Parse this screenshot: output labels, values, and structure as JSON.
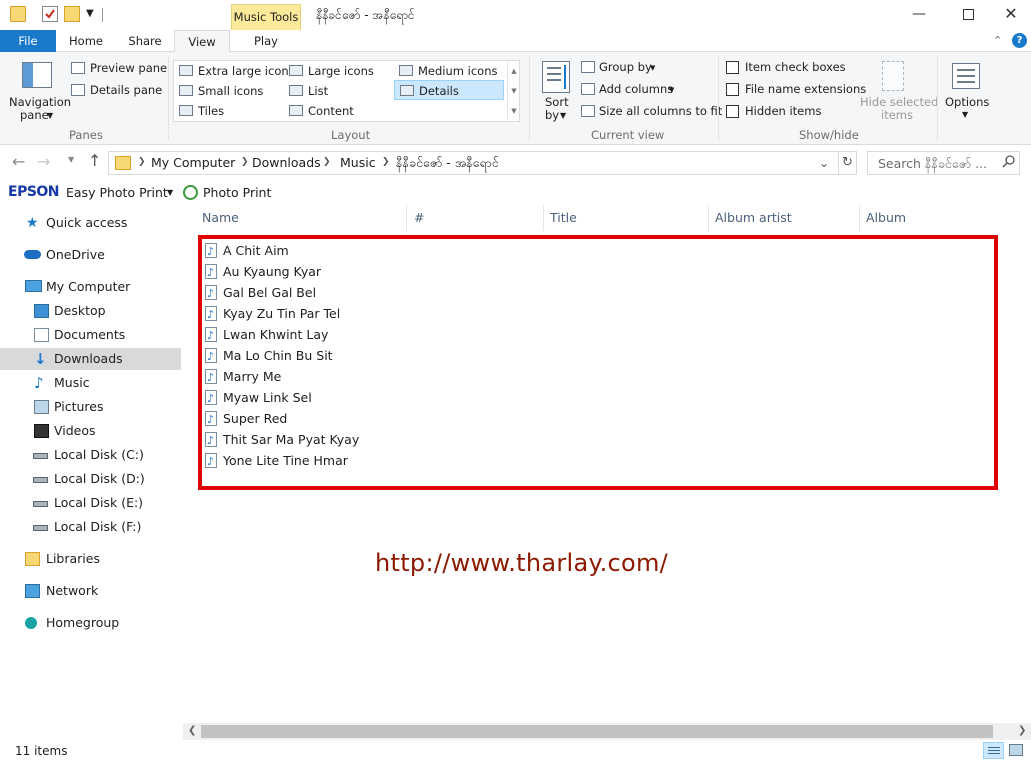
{
  "window": {
    "title": "နီနီခင်ဇော် - အနီရောင်",
    "contextual_tab": "Music Tools",
    "controls": [
      "minimize",
      "maximize",
      "close"
    ]
  },
  "ribbon_tabs": {
    "file": "File",
    "home": "Home",
    "share": "Share",
    "view": "View",
    "play": "Play",
    "active": "View"
  },
  "ribbon": {
    "panes": {
      "navigation_pane": "Navigation",
      "navigation_pane_2": "pane",
      "preview_pane": "Preview pane",
      "details_pane": "Details pane",
      "label": "Panes"
    },
    "layout": {
      "items": [
        "Extra large icons",
        "Large icons",
        "Medium icons",
        "Small icons",
        "List",
        "Details",
        "Tiles",
        "Content"
      ],
      "selected": "Details",
      "label": "Layout"
    },
    "current_view": {
      "sort_by": "Sort",
      "sort_by_2": "by",
      "group_by": "Group by",
      "add_columns": "Add columns",
      "size_all_columns": "Size all columns to fit",
      "label": "Current view"
    },
    "show_hide": {
      "item_check_boxes": "Item check boxes",
      "file_name_extensions": "File name extensions",
      "hidden_items": "Hidden items",
      "hide_selected_items": "Hide selected",
      "hide_selected_items_2": "items",
      "label": "Show/hide"
    },
    "options": {
      "label": "Options"
    }
  },
  "address": {
    "breadcrumb": [
      "My Computer",
      "Downloads",
      "Music",
      "နီနီခင်ဇော် - အနီရောင်"
    ],
    "search_placeholder": "Search နီနီခင်ဇော် ..."
  },
  "epson": {
    "brand": "EPSON",
    "app": "Easy Photo Print",
    "photo_print": "Photo Print"
  },
  "nav": {
    "items": [
      "Quick access",
      "OneDrive",
      "My Computer",
      "Desktop",
      "Documents",
      "Downloads",
      "Music",
      "Pictures",
      "Videos",
      "Local Disk (C:)",
      "Local Disk (D:)",
      "Local Disk (E:)",
      "Local Disk (F:)",
      "Libraries",
      "Network",
      "Homegroup"
    ],
    "selected": "Downloads"
  },
  "columns": [
    "Name",
    "#",
    "Title",
    "Album artist",
    "Album"
  ],
  "files": [
    "A Chit Aim",
    "Au Kyaung Kyar",
    "Gal Bel Gal Bel",
    "Kyay Zu Tin Par Tel",
    "Lwan Khwint Lay",
    "Ma Lo Chin Bu Sit",
    "Marry Me",
    "Myaw Link Sel",
    "Super Red",
    "Thit Sar Ma Pyat Kyay",
    "Yone Lite Tine Hmar"
  ],
  "watermark": "http://www.tharlay.com/",
  "status": {
    "count": "11 items"
  },
  "colors": {
    "file_tab": "#1979ca",
    "contextual_tab": "#fce99a",
    "selection": "#cce8ff",
    "nav_selected": "#d9d9d9",
    "highlight_box": "#e00000",
    "watermark": "#8b1a00"
  }
}
